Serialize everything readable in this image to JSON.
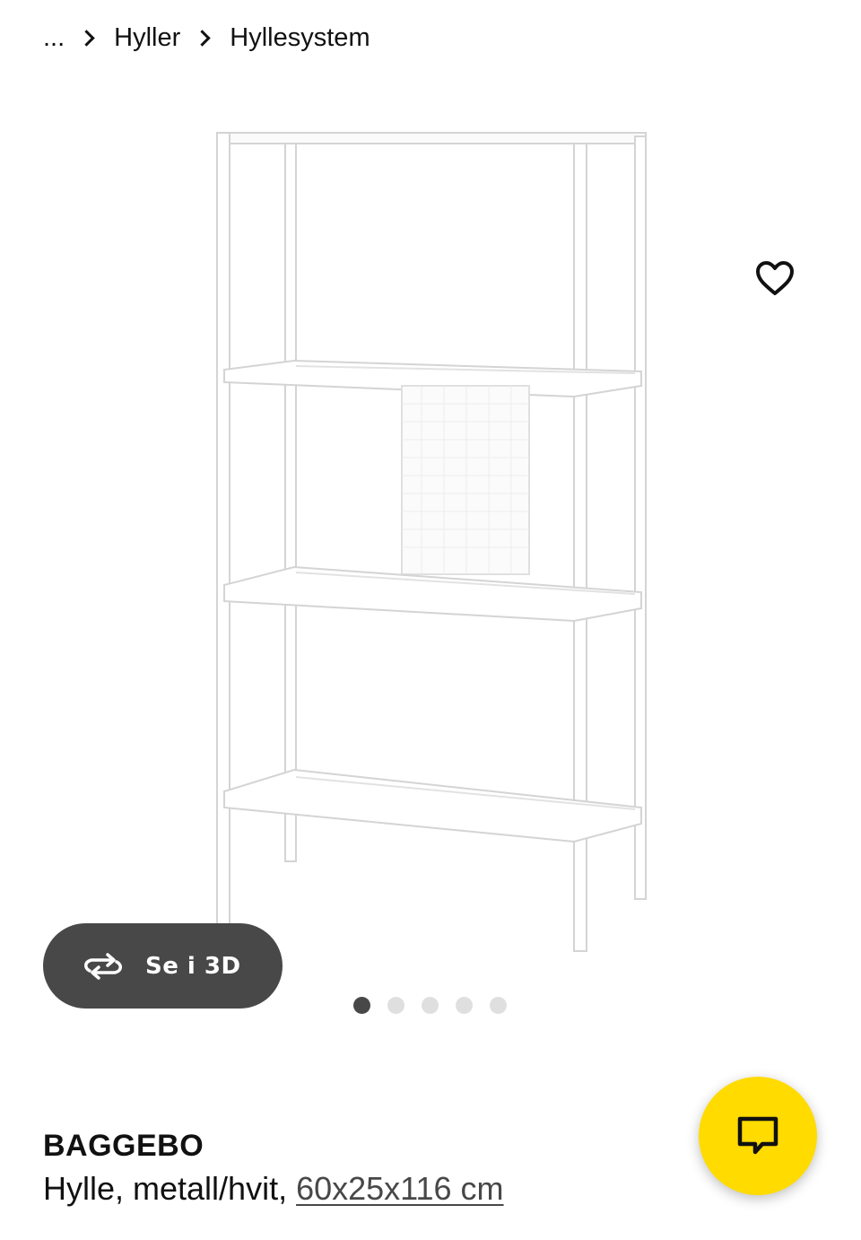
{
  "breadcrumb": {
    "ellipsis": "...",
    "items": [
      "Hyller",
      "Hyllesystem"
    ]
  },
  "product": {
    "name": "BAGGEBO",
    "description": "Hylle, metall/hvit, ",
    "size": "60x25x116 cm"
  },
  "buttons": {
    "view_3d_label": "Se i 3D",
    "view_3d_icon": "rotate-3d-icon",
    "favorite_icon": "heart-icon",
    "chat_icon": "chat-icon"
  },
  "carousel": {
    "total": 5,
    "active_index": 0
  },
  "colors": {
    "accent_yellow": "#ffdb00",
    "button_dark": "#484848",
    "text": "#111111",
    "dot_inactive": "#dfdfdf"
  }
}
